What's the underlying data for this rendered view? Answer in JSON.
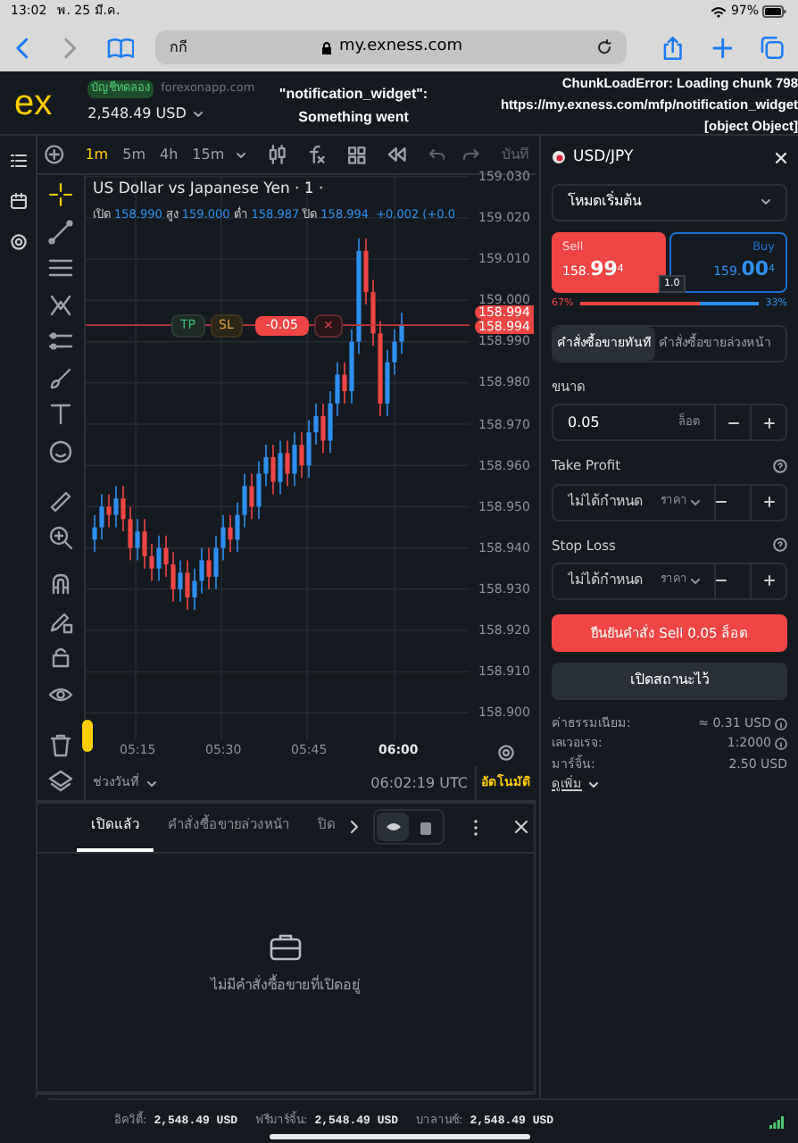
{
  "status_bar": {
    "time": "13:02",
    "date": "พ. 25 มี.ค.",
    "battery": "97%"
  },
  "browser": {
    "tab_text": "กกี",
    "url": "my.exness.com"
  },
  "header": {
    "logo": "ex",
    "account_badge": "บัญชีทดลอง",
    "server": "forexonapp.com",
    "balance": "2,548.49 USD",
    "widget_error": [
      "\"notification_widget\":",
      "Something went"
    ],
    "chunk_error": [
      "ChunkLoadError: Loading chunk 798",
      "https://my.exness.com/mfp/notification_widget",
      "[object Object]"
    ]
  },
  "chart_toolbar": {
    "timeframes": [
      {
        "label": "1m",
        "selected": true
      },
      {
        "label": "5m",
        "selected": false
      },
      {
        "label": "4h",
        "selected": false
      },
      {
        "label": "15m",
        "selected": false
      }
    ],
    "save_label": "บันทึ"
  },
  "chart": {
    "title": "US Dollar vs Japanese Yen · 1 ·",
    "ohlc": [
      {
        "label": "เปิด",
        "value": "158.990"
      },
      {
        "label": "สูง",
        "value": "159.000"
      },
      {
        "label": "ต่ำ",
        "value": "158.987"
      },
      {
        "label": "ปิด",
        "value": "158.994"
      }
    ],
    "change": "+0.002 (+0.0",
    "price_axis": [
      "159.030",
      "159.020",
      "159.010",
      "159.000",
      "158.990",
      "158.980",
      "158.970",
      "158.960",
      "158.950",
      "158.940",
      "158.930",
      "158.920",
      "158.910",
      "158.900"
    ],
    "time_axis": [
      {
        "label": "05:15",
        "bold": false
      },
      {
        "label": "05:30",
        "bold": false
      },
      {
        "label": "05:45",
        "bold": false
      },
      {
        "label": "06:00",
        "bold": true
      }
    ],
    "price_tags": [
      "158.994",
      "158.994"
    ],
    "position_line": {
      "tp": "TP",
      "sl": "SL",
      "pnl": "-0.05",
      "close": "×"
    },
    "range_label": "ช่วงวันที่",
    "clock": "06:02:19 UTC",
    "auto_label": "อัตโนมัติ"
  },
  "order_panel": {
    "symbol": "USD/JPY",
    "mode": "โหมดเริ่มต้น",
    "sell": {
      "label": "Sell",
      "price_main": "158.",
      "price_big": "99",
      "price_sup": "4"
    },
    "buy": {
      "label": "Buy",
      "price_main": "159.",
      "price_big": "00",
      "price_sup": "4"
    },
    "spread": "1.0",
    "sell_pct": "67%",
    "buy_pct": "33%",
    "level": 0.67,
    "order_tabs": [
      {
        "label": "คำสั่งซื้อขายทันที",
        "selected": true
      },
      {
        "label": "คำสั่งซื้อขายล่วงหน้า",
        "selected": false
      }
    ],
    "volume": {
      "label": "ขนาด",
      "value": "0.05",
      "unit": "ล็อต"
    },
    "take_profit": {
      "label": "Take Profit",
      "placeholder": "ไม่ได้กำหนด",
      "unit": "ราคา"
    },
    "stop_loss": {
      "label": "Stop Loss",
      "placeholder": "ไม่ได้กำหนด",
      "unit": "ราคา"
    },
    "confirm_button": "ยืนยันคำสั่ง Sell 0.05 ล็อต",
    "cancel_button": "เปิดสถานะไว้",
    "details": [
      {
        "label": "ค่าธรรมเนียม:",
        "value": "≈ 0.31 USD",
        "info": true
      },
      {
        "label": "เลเวอเรจ:",
        "value": "1:2000",
        "info": true
      },
      {
        "label": "มาร์จิ้น:",
        "value": "2.50 USD",
        "info": false
      }
    ],
    "more": "ดูเพิ่ม"
  },
  "bottom_panel": {
    "tabs": [
      {
        "label": "เปิดแล้ว",
        "selected": true
      },
      {
        "label": "คำสั่งซื้อขายล่วงหน้า",
        "selected": false
      },
      {
        "label": "ปิด",
        "selected": false
      }
    ],
    "view_toggle": [
      {
        "selected": true
      },
      {
        "selected": false
      }
    ],
    "empty_message": "ไม่มีคำสั่งซื้อขายที่เปิดอยู่"
  },
  "footer": [
    {
      "label": "อิควิตี้:",
      "value": "2,548.49 USD"
    },
    {
      "label": "ฟรีมาร์จิ้น:",
      "value": "2,548.49 USD"
    },
    {
      "label": "บาลานซ์:",
      "value": "2,548.49 USD"
    }
  ]
}
